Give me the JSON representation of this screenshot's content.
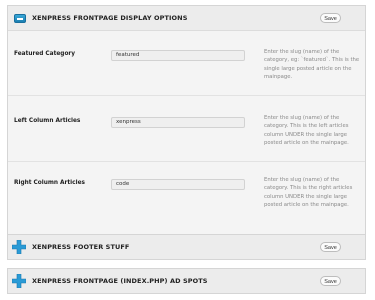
{
  "panels": [
    {
      "title": "XENPRESS FRONTPAGE DISPLAY OPTIONS",
      "save": "Save",
      "rows": [
        {
          "label": "Featured Category",
          "value": "featured",
          "description": "Enter the slug (name) of the category, eg: `featured`. This is the single large posted article on the mainpage."
        },
        {
          "label": "Left Column Articles",
          "value": "xenpress",
          "description": "Enter the slug (name) of the category. This is the left articles column UNDER the single large posted article on the mainpage."
        },
        {
          "label": "Right Column Articles",
          "value": "code",
          "description": "Enter the slug (name) of the category. This is the right articles column UNDER the single large posted article on the mainpage."
        }
      ]
    },
    {
      "title": "XENPRESS FOOTER STUFF",
      "save": "Save"
    },
    {
      "title": "XENPRESS FRONTPAGE (INDEX.PHP) AD SPOTS",
      "save": "Save"
    }
  ],
  "colors": {
    "accent": "#1c7fb2",
    "plus_icon": "#2a9bd6"
  }
}
